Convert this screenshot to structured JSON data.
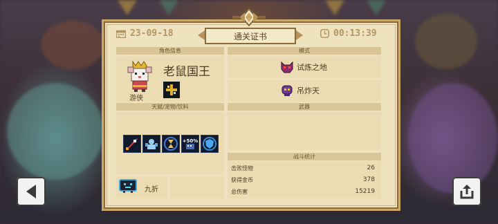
{
  "header": {
    "date": "23-09-18",
    "title": "通关证书",
    "time": "00:13:39"
  },
  "role": {
    "section": "角色信息",
    "name": "老鼠国王",
    "class": "游侠"
  },
  "mode": {
    "section": "模式",
    "items": [
      {
        "label": "试炼之地",
        "icon": "purple-demon-mask-icon"
      },
      {
        "label": "吊炸天",
        "icon": "purple-skull-mask-icon"
      }
    ]
  },
  "talents": {
    "section": "天赋/宠物/饮料",
    "icons": [
      "rocket-talent-icon",
      "muscle-talent-icon",
      "hourglass-talent-icon",
      "plus-fifty-percent-icon",
      "shield-talent-icon"
    ],
    "talent4_text": "+50%"
  },
  "drink": {
    "label": "九折",
    "icon": "tv-robot-icon"
  },
  "weapon": {
    "section": "武器"
  },
  "stats": {
    "section": "战斗统计",
    "rows": [
      {
        "label": "击败怪物",
        "value": "26"
      },
      {
        "label": "获得金币",
        "value": "378"
      },
      {
        "label": "总伤害",
        "value": "15219"
      }
    ]
  },
  "controls": {
    "back": "back-arrow-icon",
    "share": "share-icon"
  },
  "colors": {
    "paper": "#efe2be",
    "border": "#c9a86a",
    "header_text": "#b39663",
    "section_head": "#d9c596"
  }
}
